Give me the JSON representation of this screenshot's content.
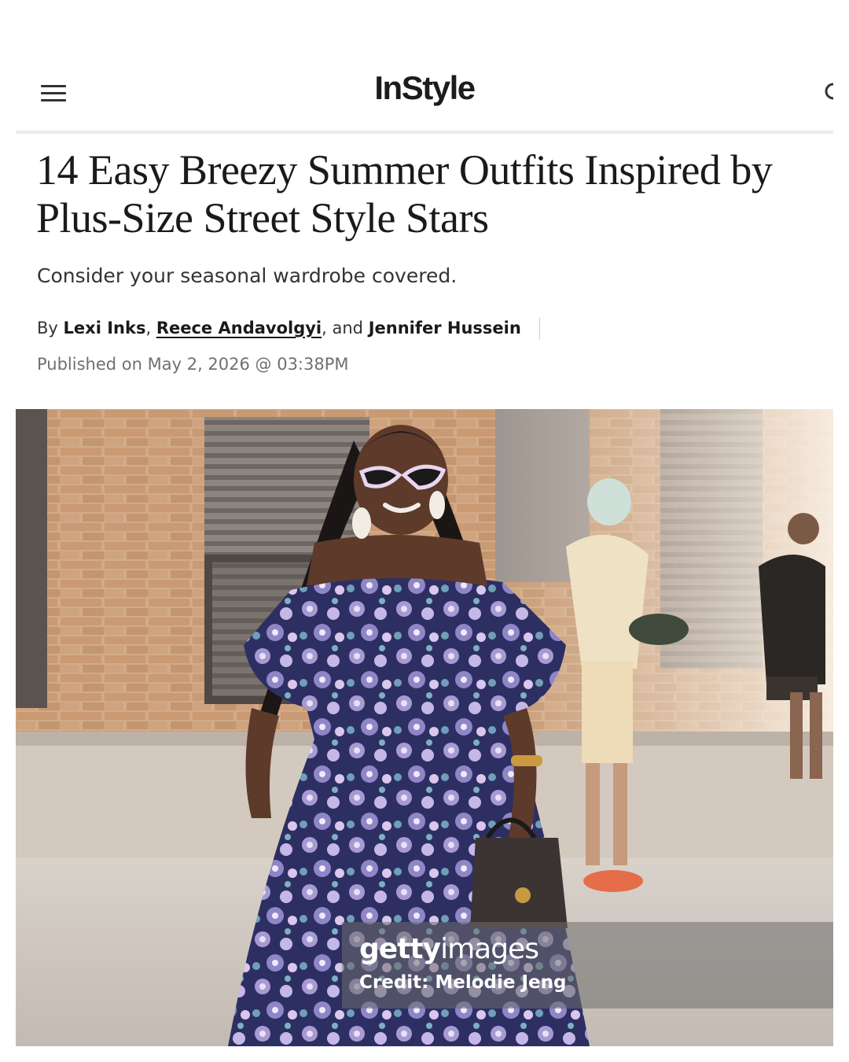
{
  "header": {
    "brand": "InStyle",
    "menu_icon": "hamburger-menu-icon",
    "search_icon": "search-icon"
  },
  "article": {
    "headline": "14 Easy Breezy Summer Outfits Inspired by Plus-Size Street Style Stars",
    "dek": "Consider your seasonal wardrobe covered.",
    "byline": {
      "prefix": "By",
      "author1": "Lexi Inks",
      "comma1": ",",
      "author2": "Reece Andavolgyi",
      "conj": ", and",
      "author3": "Jennifer Hussein"
    },
    "published": "Published on May 2, 2026 @ 03:38PM"
  },
  "hero_image": {
    "watermark_brand_bold": "getty",
    "watermark_brand_light": "images",
    "credit": "Credit: Melodie Jeng"
  },
  "colors": {
    "dress": "#5b5a9a",
    "brick": "#c99f7c",
    "background": "#ffffff"
  }
}
